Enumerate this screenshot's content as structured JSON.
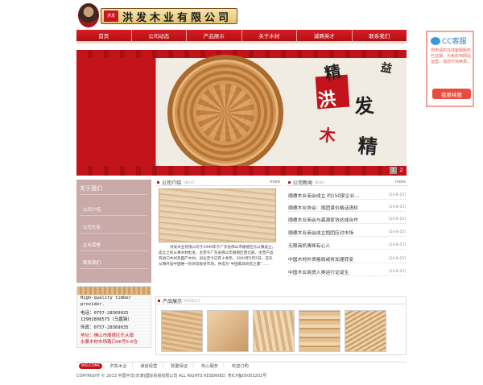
{
  "header": {
    "company_name": "洪发木业有限公司",
    "seal_text": "洪发"
  },
  "nav": {
    "items": [
      "首页",
      "公司动态",
      "产品展示",
      "关于木材",
      "诚聘英才",
      "联系我们"
    ]
  },
  "banner": {
    "calligraphy": [
      "洪",
      "木",
      "发",
      "精",
      "精",
      "益"
    ],
    "pager": [
      "1",
      "2"
    ],
    "active_page": "2"
  },
  "about": {
    "title": "关于我们",
    "links": [
      "公司介绍",
      "公司文化",
      "企业荣誉",
      "联系我们"
    ]
  },
  "contact": {
    "lines": [
      "High-quality timber",
      "provider.",
      "电话：0757-28369025",
      "       13902808575（马嘉锋）",
      "传真：0757-28369035",
      "地址：佛山市顺德区乐从镇",
      "水藤木材市场路口96号5-6仓"
    ]
  },
  "intro": {
    "heading": "公司介绍",
    "heading_sub": "ABOUT",
    "more": "more",
    "text": "洪发木业有限公司于1999年于广东省佛山市顺德区乐从镇成立，成立之初从事木材批发，主营于广东省佛山市顺德区西北部，主营产品有进口木材及国产木材。创业至今已有十余年，2004年5月5日，在乐从镇开设中国唯一的商贸板材市场，并成为“中国家具商贸之都”……"
  },
  "news": {
    "heading": "公司新闻",
    "heading_sub": "NEWS",
    "more": "more",
    "items": [
      {
        "title": "顺德木业商会成立 约150家企业…",
        "date": "[14-8-15]"
      },
      {
        "title": "顺德木业协会：抱团谋价格话语权",
        "date": "[14-8-15]"
      },
      {
        "title": "顺德木业商会与森源家协达成合作",
        "date": "[14-8-15]"
      },
      {
        "title": "顺德木业商会成立抱团应对市场",
        "date": "[14-8-15]"
      },
      {
        "title": "无限商机青睐有心人",
        "date": "[14-8-15]"
      },
      {
        "title": "中国木材外贸格局或将加速转变",
        "date": "[14-8-15]"
      },
      {
        "title": "中国木业商贸入奥运行证诞生",
        "date": "[14-8-15]"
      }
    ]
  },
  "products": {
    "heading": "产品展示",
    "heading_sub": "PRODUCT"
  },
  "footer": {
    "welcome": "WELCOME",
    "links": [
      "洪发木业",
      "诚信经营",
      "質量保证",
      "热心服务",
      "欢迎订购"
    ],
    "copyright": "COPYRIGHT © 2013 中国中洋(天津)国际贸易有限公司 ALL RIGHTS RESERVED. 粤ICP备05003202号"
  },
  "cc_service": {
    "title": "CC客服",
    "text": "您申请的在线客服服务已过期，为免影响网站运营，请您尽快续费。",
    "button": "我要续费"
  }
}
